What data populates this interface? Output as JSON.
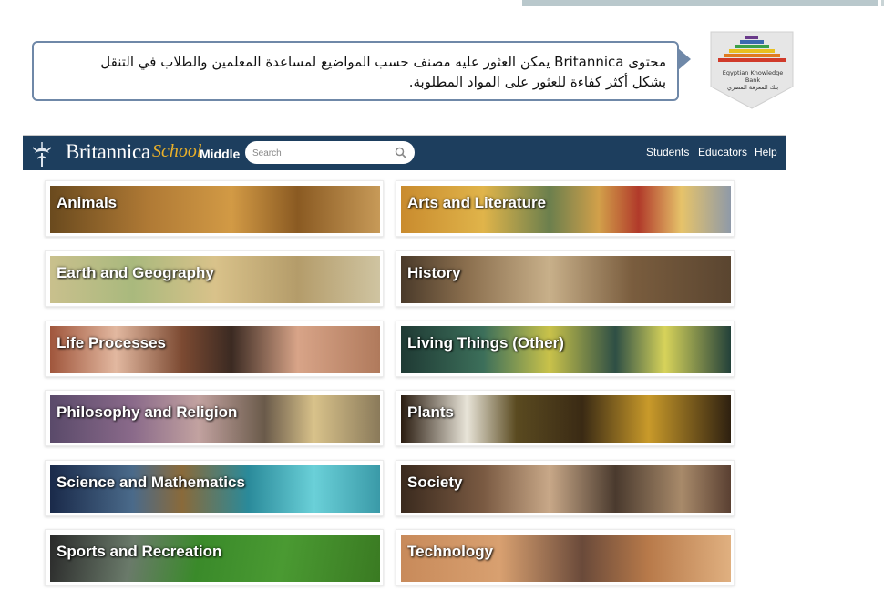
{
  "callout": {
    "text": "محتوى Britannica يمكن العثور عليه مصنف حسب المواضيع لمساعدة المعلمين والطلاب في التنقل\nبشكل أكثر كفاءة للعثور على المواد المطلوبة."
  },
  "logo": {
    "line1": "Egyptian Knowledge Bank",
    "line2": "بنك المعرفة المصري"
  },
  "header": {
    "brand": "Britannica",
    "brand_suffix": "School",
    "level": "Middle",
    "search_placeholder": "Search",
    "nav": [
      "Students",
      "Educators",
      "Help"
    ]
  },
  "categories": [
    {
      "label": "Animals"
    },
    {
      "label": "Arts and Literature"
    },
    {
      "label": "Earth and Geography"
    },
    {
      "label": "History"
    },
    {
      "label": "Life Processes"
    },
    {
      "label": "Living Things (Other)"
    },
    {
      "label": "Philosophy and Religion"
    },
    {
      "label": "Plants"
    },
    {
      "label": "Science and Mathematics"
    },
    {
      "label": "Society"
    },
    {
      "label": "Sports and Recreation"
    },
    {
      "label": "Technology"
    }
  ],
  "colors": {
    "navbar": "#1d3e5e",
    "school_accent": "#e9b02a",
    "callout_border": "#6f88a8"
  }
}
